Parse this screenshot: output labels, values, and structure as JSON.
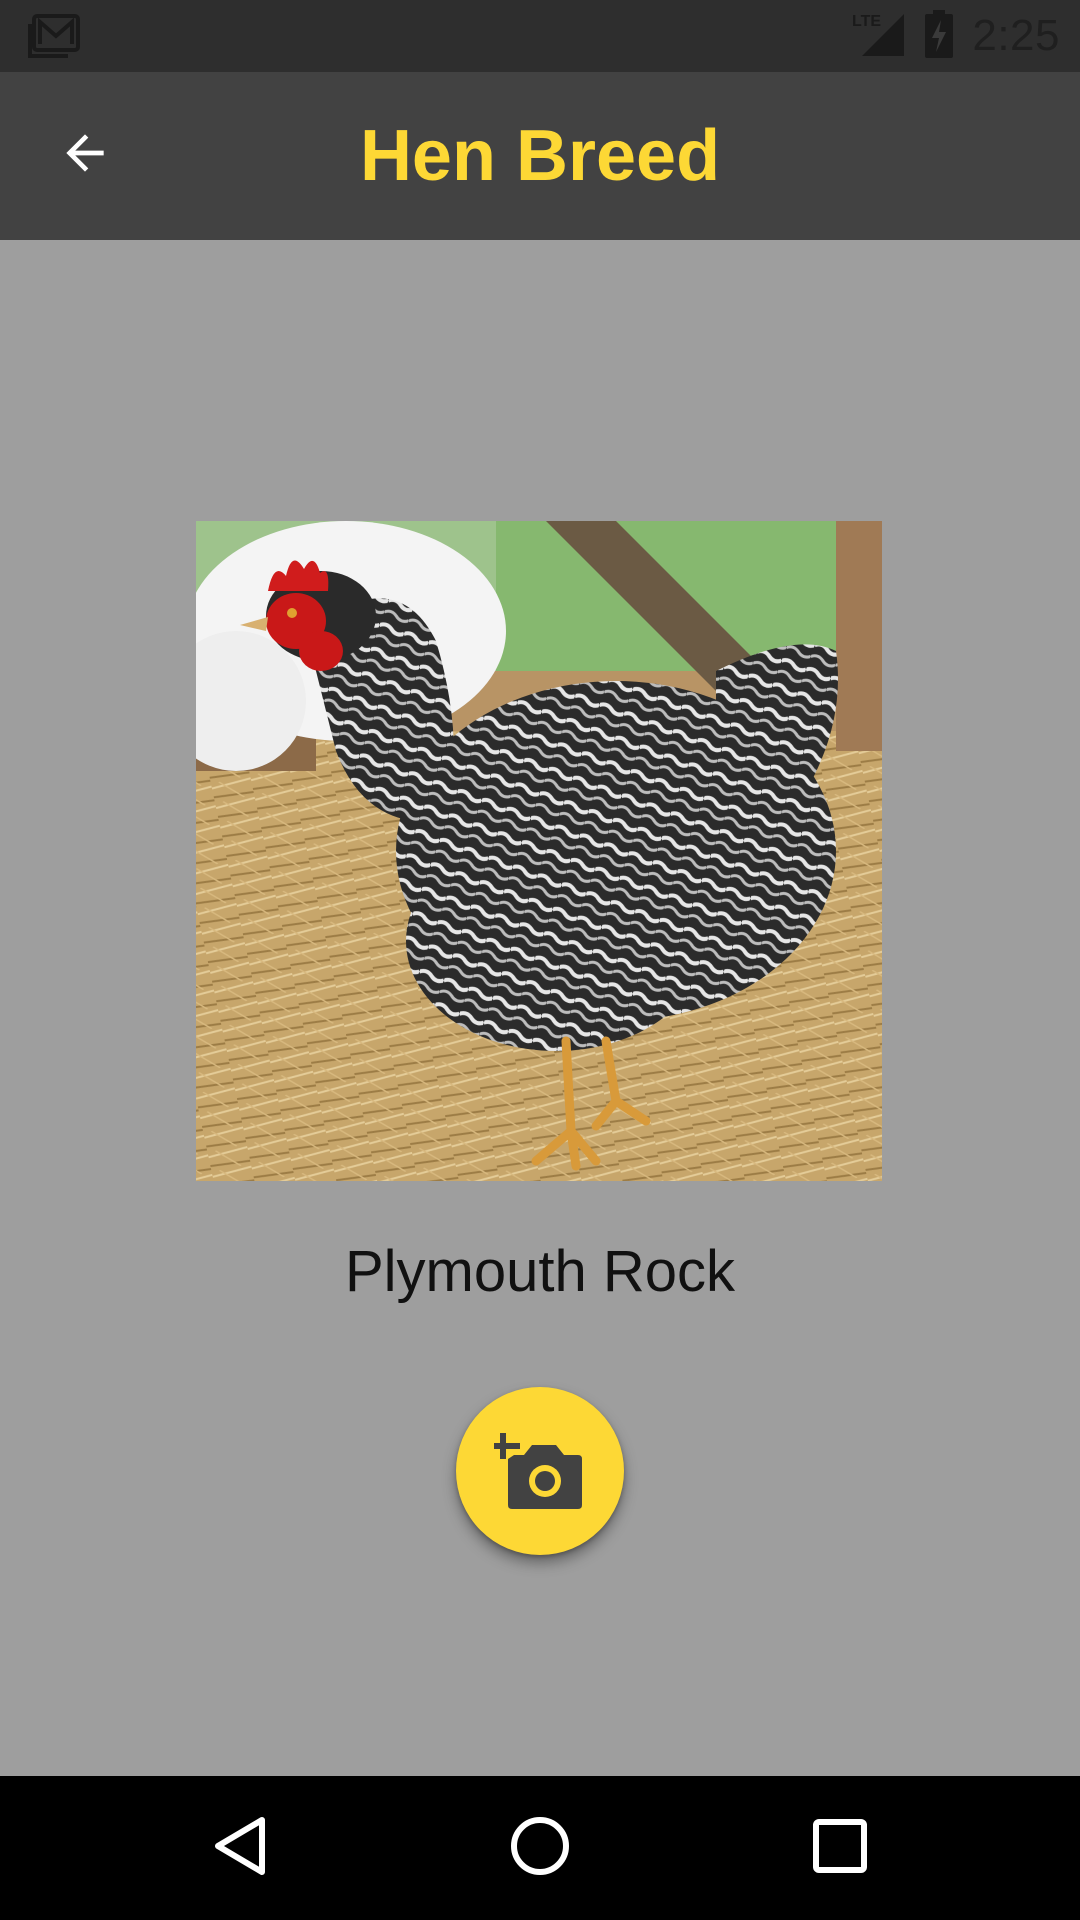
{
  "status_bar": {
    "time": "2:25",
    "network_label": "LTE",
    "left_icon": "gallery-icon",
    "signal_icon": "signal-icon",
    "battery_icon": "battery-charging-icon"
  },
  "app_bar": {
    "title": "Hen Breed",
    "back_icon": "arrow-back-icon"
  },
  "content": {
    "breed_name": "Plymouth Rock",
    "fab_icon": "add-photo-icon"
  },
  "nav_bar": {
    "back_icon": "nav-back-icon",
    "home_icon": "nav-home-icon",
    "recents_icon": "nav-recents-icon"
  },
  "colors": {
    "accent": "#fdd835",
    "app_bar": "#424242",
    "status_bar": "#2e2e2e",
    "background": "#9e9e9e"
  }
}
